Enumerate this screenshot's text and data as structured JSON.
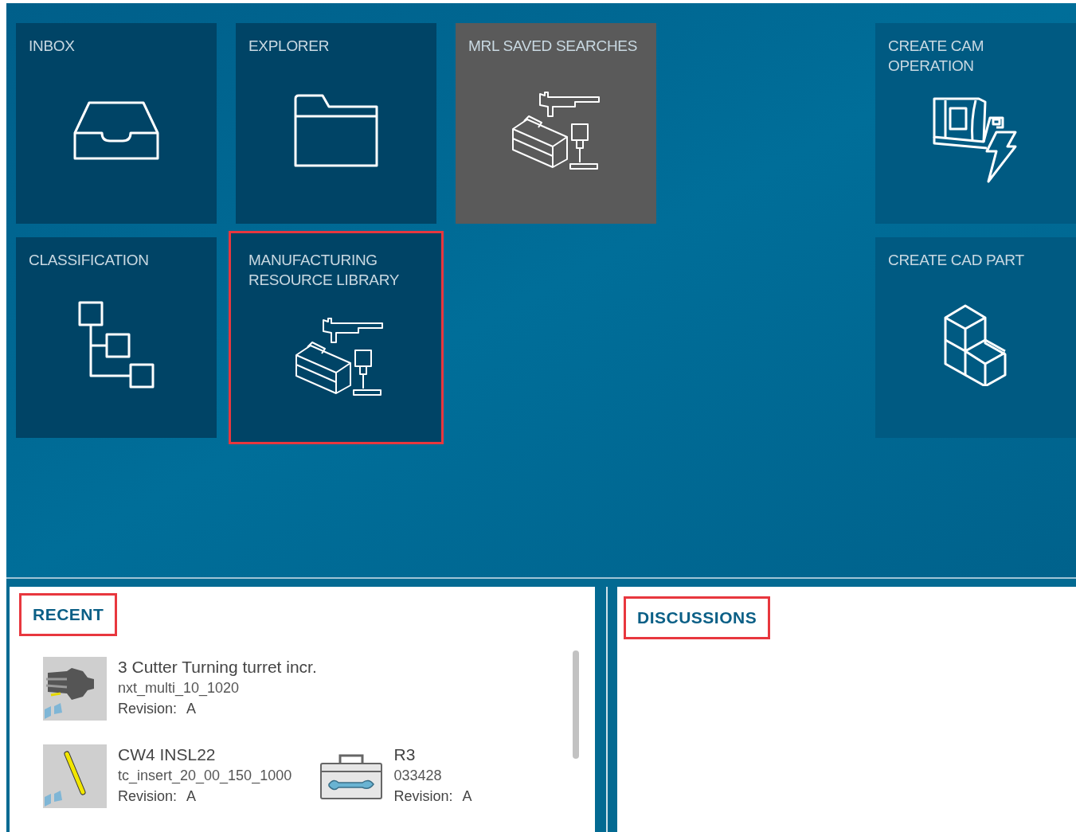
{
  "left_tiles": [
    {
      "label": "INBOX",
      "kind": "inbox",
      "color": "#004466",
      "highlighted": false
    },
    {
      "label": "EXPLORER",
      "kind": "folder",
      "color": "#004466",
      "highlighted": false
    },
    {
      "label": "MRL SAVED SEARCHES",
      "kind": "tools",
      "color": "#5a5a5a",
      "highlighted": false
    },
    {
      "label": "CLASSIFICATION",
      "kind": "tree",
      "color": "#004466",
      "highlighted": false
    },
    {
      "label": "MANUFACTURING RESOURCE LIBRARY",
      "kind": "tools",
      "color": "#004466",
      "highlighted": true
    }
  ],
  "right_tiles": [
    {
      "label": "CREATE CAM OPERATION",
      "kind": "machine",
      "color": "#005a82",
      "highlighted": false
    },
    {
      "label": "CREATE CAD PART",
      "kind": "cubes",
      "color": "#005a82",
      "highlighted": false
    }
  ],
  "recent": {
    "title": "RECENT",
    "highlighted": true,
    "rows": [
      [
        {
          "kind": "turret",
          "name": "3 Cutter Turning turret incr.",
          "id": "nxt_multi_10_1020",
          "revision_label": "Revision:",
          "revision": "A"
        }
      ],
      [
        {
          "kind": "insert",
          "name": "CW4 INSL22",
          "id": "tc_insert_20_00_150_1000",
          "revision_label": "Revision:",
          "revision": "A"
        },
        {
          "kind": "toolbox",
          "name": "R3",
          "id": "033428",
          "revision_label": "Revision:",
          "revision": "A"
        }
      ]
    ]
  },
  "discussions": {
    "title": "DISCUSSIONS",
    "highlighted": true
  }
}
